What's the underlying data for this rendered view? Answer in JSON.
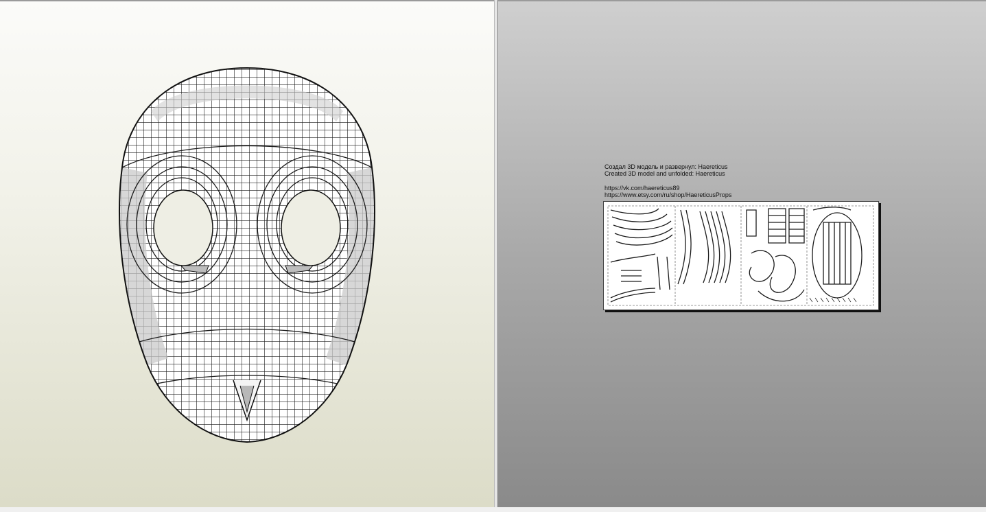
{
  "credits": {
    "line_ru": "Создал 3D модель и развернул: Haereticus",
    "line_en": "Created 3D model and unfolded: Haereticus",
    "url_vk": "https://vk.com/haereticus89",
    "url_etsy": "https://www.etsy.com/ru/shop/HaereticusProps"
  },
  "icons": {
    "mask": "mask-3d-model",
    "pattern": "unfolded-pattern-sheet"
  }
}
